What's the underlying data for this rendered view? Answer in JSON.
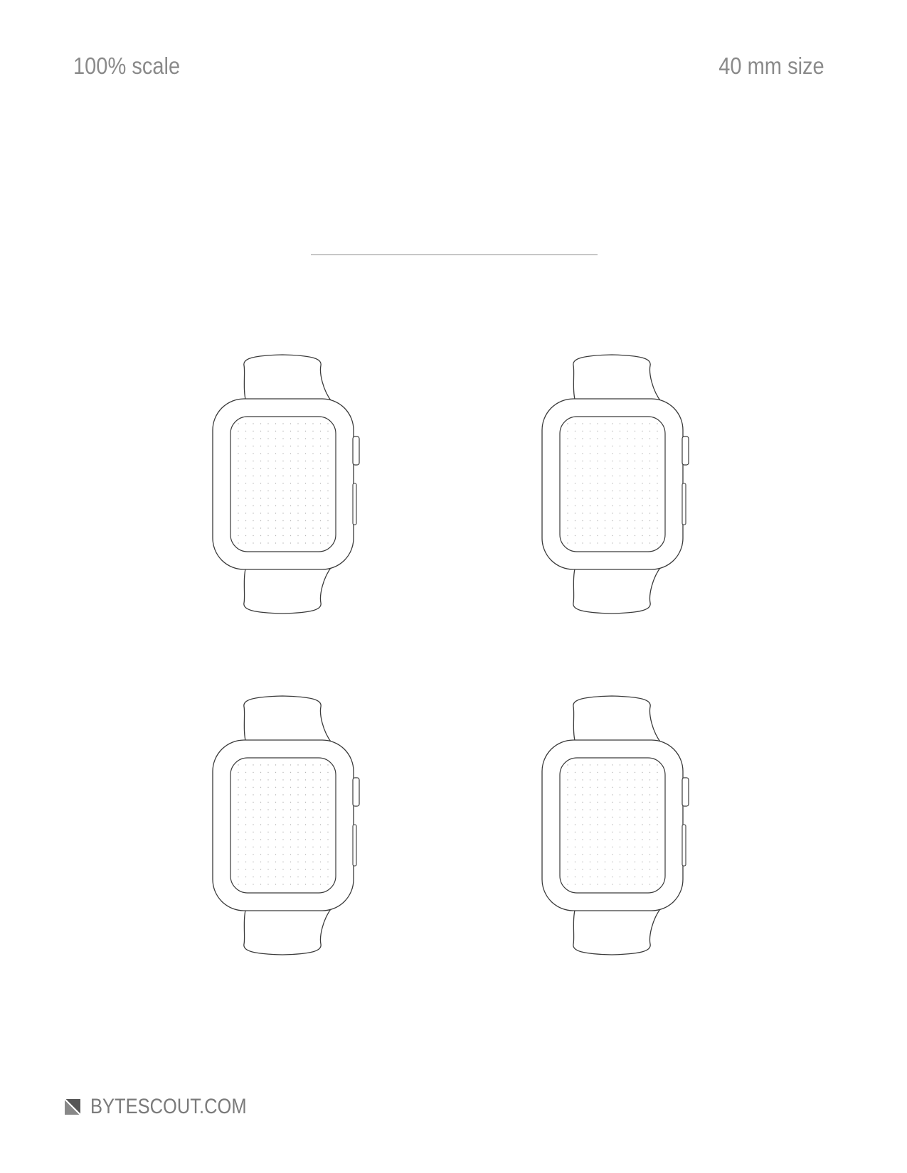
{
  "header": {
    "scale_label": "100% scale",
    "size_label": "40 mm size"
  },
  "watches": [
    {
      "icon": "smartwatch-outline"
    },
    {
      "icon": "smartwatch-outline"
    },
    {
      "icon": "smartwatch-outline"
    },
    {
      "icon": "smartwatch-outline"
    }
  ],
  "footer": {
    "logo_icon": "bytescout-logo",
    "brand_text": "BYTESCOUT.COM"
  }
}
